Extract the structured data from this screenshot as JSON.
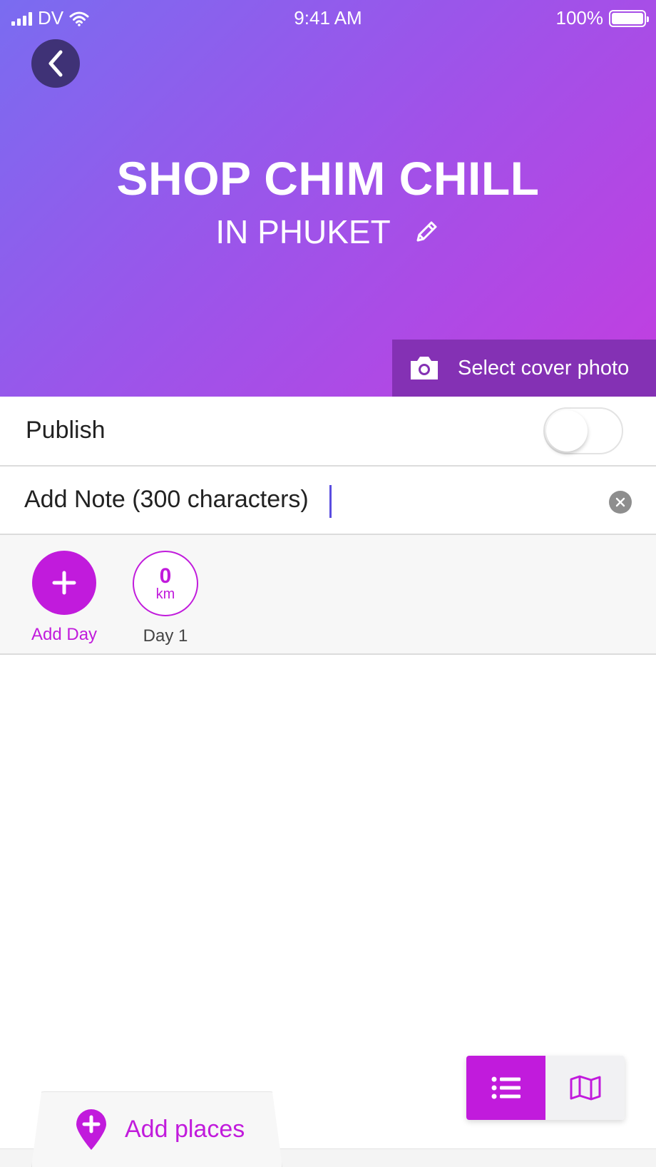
{
  "status_bar": {
    "carrier": "DV",
    "time": "9:41 AM",
    "battery": "100%"
  },
  "header": {
    "title": "SHOP CHIM CHILL",
    "subtitle": "IN PHUKET",
    "cover_photo_label": "Select cover photo"
  },
  "publish": {
    "label": "Publish",
    "enabled": false
  },
  "note": {
    "placeholder": "Add Note (300 characters)",
    "value": ""
  },
  "days": {
    "add_day_label": "Add Day",
    "items": [
      {
        "distance_value": "0",
        "distance_unit": "km",
        "label": "Day 1"
      }
    ]
  },
  "bottom": {
    "add_places_label": "Add places"
  },
  "colors": {
    "accent": "#c11bdc",
    "gradient_start": "#7a6cf0",
    "gradient_end": "#c23ee0",
    "back_button": "#3f3276",
    "cover_button": "#8431b4"
  }
}
